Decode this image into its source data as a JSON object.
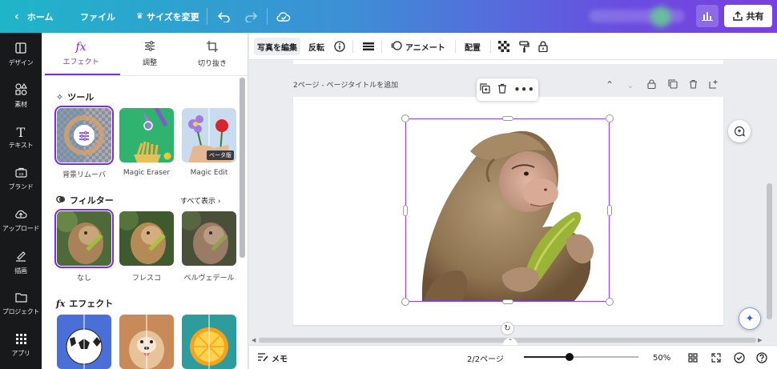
{
  "topbar": {
    "home_label": "ホーム",
    "file_label": "ファイル",
    "resize_label": "サイズを変更",
    "share_label": "共有"
  },
  "rail": {
    "items": [
      {
        "label": "デザイン",
        "icon": "layout-icon"
      },
      {
        "label": "素材",
        "icon": "shapes-icon"
      },
      {
        "label": "テキスト",
        "icon": "text-icon"
      },
      {
        "label": "ブランド",
        "icon": "brand-icon"
      },
      {
        "label": "アップロード",
        "icon": "upload-icon"
      },
      {
        "label": "描画",
        "icon": "draw-icon"
      },
      {
        "label": "プロジェクト",
        "icon": "folder-icon"
      },
      {
        "label": "アプリ",
        "icon": "apps-icon"
      }
    ]
  },
  "panel": {
    "tabs": [
      {
        "label": "エフェクト",
        "active": true
      },
      {
        "label": "調整",
        "active": false
      },
      {
        "label": "切り抜き",
        "active": false
      }
    ],
    "tools_heading": "ツール",
    "tools": [
      {
        "label": "背景リムーバ"
      },
      {
        "label": "Magic Eraser"
      },
      {
        "label": "Magic Edit",
        "badge": "ベータ版"
      }
    ],
    "filters_heading": "フィルター",
    "filters_link": "すべて表示",
    "filters": [
      {
        "label": "なし"
      },
      {
        "label": "フレスコ"
      },
      {
        "label": "ベルヴェデール"
      }
    ],
    "effects_heading": "エフェクト"
  },
  "toolbar": {
    "edit_photo": "写真を編集",
    "flip": "反転",
    "animate": "アニメート",
    "position": "配置"
  },
  "page": {
    "title": "2ページ - ページタイトルを追加"
  },
  "bottom": {
    "notes": "メモ",
    "page_counter": "2/2ページ",
    "zoom": "50%",
    "zoom_fraction": 0.4
  },
  "colors": {
    "accent": "#7d2ae8",
    "selection": "#8b3dff"
  }
}
